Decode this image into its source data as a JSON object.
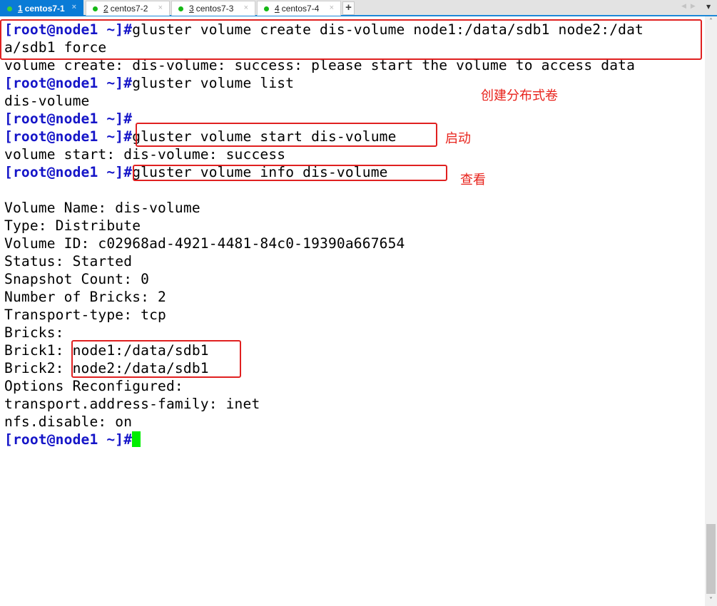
{
  "tabs": [
    {
      "num": "1",
      "label": "centos7-1",
      "active": true,
      "status_color": "#3bd23b"
    },
    {
      "num": "2",
      "label": "centos7-2",
      "active": false,
      "status_color": "#16b816"
    },
    {
      "num": "3",
      "label": "centos7-3",
      "active": false,
      "status_color": "#16b816"
    },
    {
      "num": "4",
      "label": "centos7-4",
      "active": false,
      "status_color": "#16b816"
    }
  ],
  "tabbar": {
    "close_glyph": "×",
    "new_tab_glyph": "+",
    "prev_glyph": "◀",
    "next_glyph": "▶",
    "menu_glyph": "▼"
  },
  "terminal": {
    "prompt": "[root@node1 ~]#",
    "lines": [
      {
        "type": "cmd",
        "text": "gluster volume create dis-volume node1:/data/sdb1 node2:/dat"
      },
      {
        "type": "out",
        "text": "a/sdb1 force"
      },
      {
        "type": "out",
        "text": "volume create: dis-volume: success: please start the volume to access data"
      },
      {
        "type": "cmd",
        "text": "gluster volume list"
      },
      {
        "type": "out",
        "text": "dis-volume"
      },
      {
        "type": "cmd",
        "text": ""
      },
      {
        "type": "cmd",
        "text": "gluster volume start dis-volume"
      },
      {
        "type": "out",
        "text": "volume start: dis-volume: success"
      },
      {
        "type": "cmd",
        "text": "gluster volume info dis-volume"
      },
      {
        "type": "out",
        "text": ""
      },
      {
        "type": "out",
        "text": "Volume Name: dis-volume"
      },
      {
        "type": "out",
        "text": "Type: Distribute"
      },
      {
        "type": "out",
        "text": "Volume ID: c02968ad-4921-4481-84c0-19390a667654"
      },
      {
        "type": "out",
        "text": "Status: Started"
      },
      {
        "type": "out",
        "text": "Snapshot Count: 0"
      },
      {
        "type": "out",
        "text": "Number of Bricks: 2"
      },
      {
        "type": "out",
        "text": "Transport-type: tcp"
      },
      {
        "type": "out",
        "text": "Bricks:"
      },
      {
        "type": "out",
        "text": "Brick1: node1:/data/sdb1"
      },
      {
        "type": "out",
        "text": "Brick2: node2:/data/sdb1"
      },
      {
        "type": "out",
        "text": "Options Reconfigured:"
      },
      {
        "type": "out",
        "text": "transport.address-family: inet"
      },
      {
        "type": "out",
        "text": "nfs.disable: on"
      },
      {
        "type": "cursor",
        "text": ""
      }
    ]
  },
  "annotations": {
    "create_note": "创建分布式卷",
    "start_note": "启动",
    "info_note": "查看",
    "color": "#e02020"
  },
  "scrollbar": {
    "up_glyph": "˄",
    "down_glyph": "˅"
  }
}
